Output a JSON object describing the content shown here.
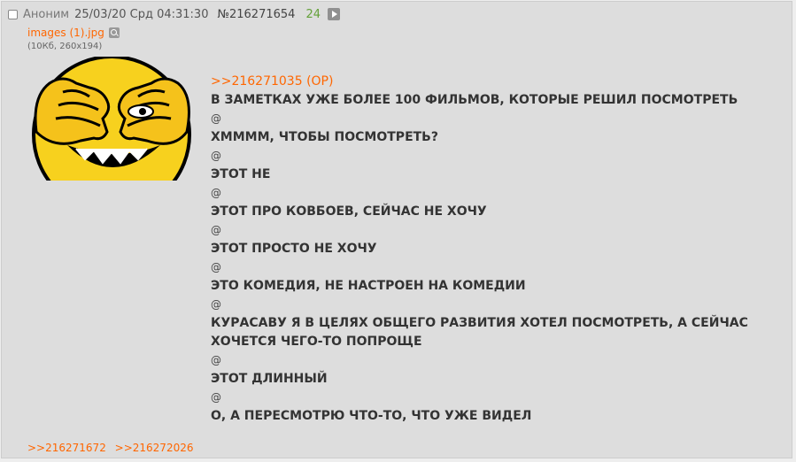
{
  "post": {
    "author": "Аноним",
    "date": "25/03/20 Срд 04:31:30",
    "number": "№216271654",
    "count": "24",
    "file_name": "images (1).jpg",
    "file_meta": "(10Кб, 260x194)",
    "reply_link": ">>216271035 (OP)",
    "lines": [
      "В ЗАМЕТКАХ УЖЕ БОЛЕЕ 100 ФИЛЬМОВ, КОТОРЫЕ РЕШИЛ ПОСМОТРЕТЬ",
      "@",
      "ХМММM, ЧТОБЫ ПОСМОТРЕТЬ?",
      "@",
      "ЭТОТ НЕ",
      "@",
      "ЭТОТ ПРО КОВБОЕВ, СЕЙЧАС НЕ ХОЧУ",
      "@",
      "ЭТОТ ПРОСТО НЕ ХОЧУ",
      "@",
      "ЭТО КОМЕДИЯ, НЕ НАСТРОЕН НА КОМЕДИИ",
      "@",
      "КУРАСАВУ Я В ЦЕЛЯХ ОБЩЕГО РАЗВИТИЯ ХОТЕЛ ПОСМОТРЕТЬ, А СЕЙЧАС",
      "ХОЧЕТСЯ ЧЕГО-ТО ПОПРОЩЕ",
      "@",
      "ЭТОТ ДЛИННЫЙ",
      "@",
      "О, А ПЕРЕСМОТРЮ ЧТО-ТО, ЧТО УЖЕ ВИДЕЛ"
    ],
    "replies": [
      ">>216271672",
      ">>216272026"
    ]
  }
}
